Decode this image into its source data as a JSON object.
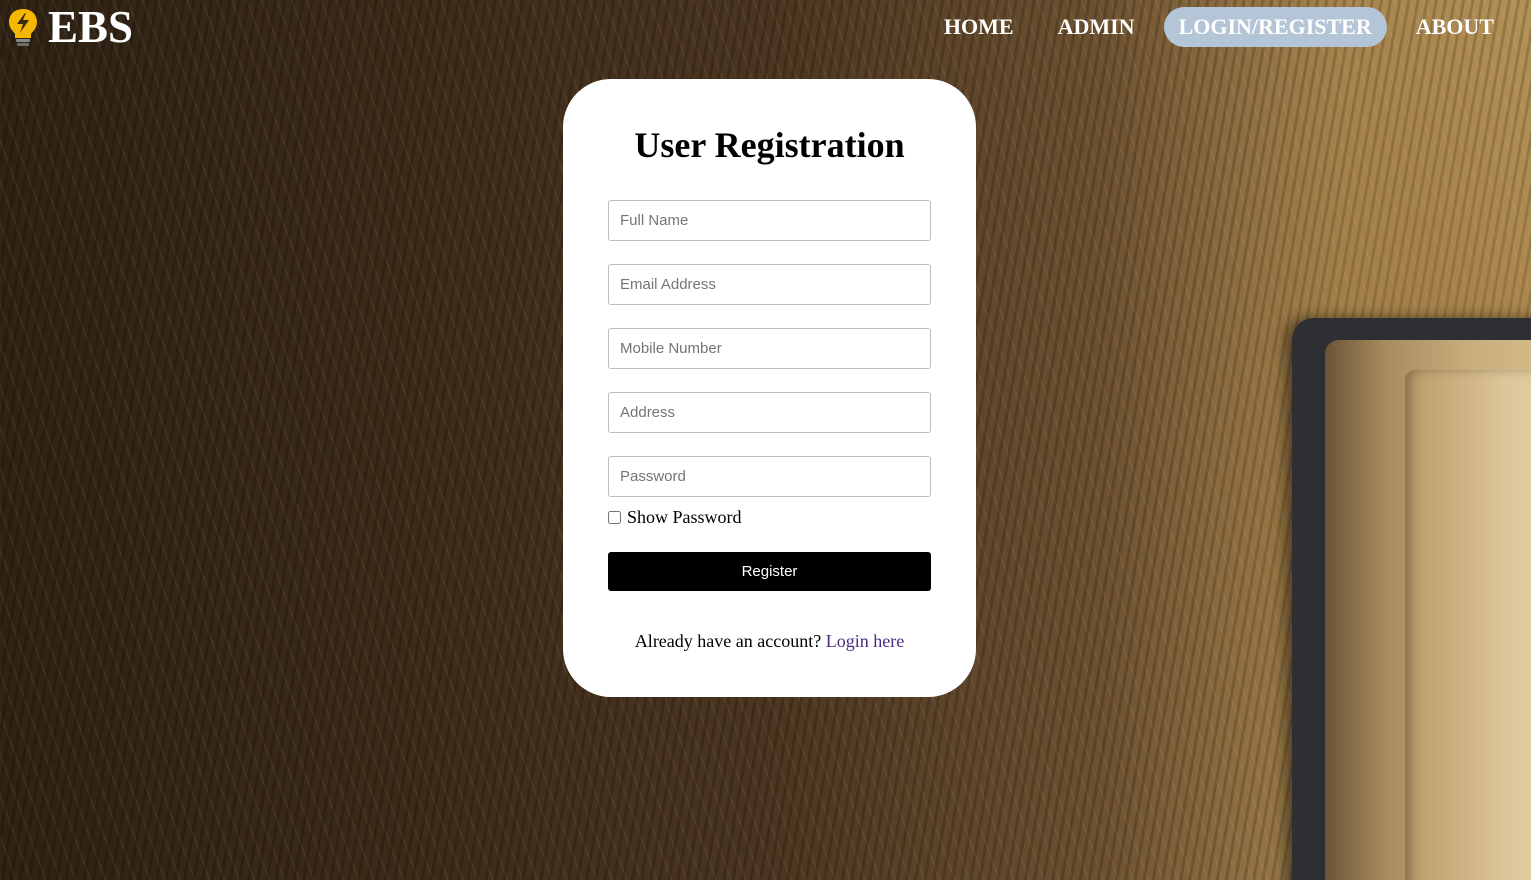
{
  "brand": {
    "name": "EBS",
    "logo_icon": "lightbulb-bolt-icon",
    "logo_color": "#f5b700"
  },
  "nav": {
    "items": [
      {
        "label": "HOME",
        "active": false
      },
      {
        "label": "ADMIN",
        "active": false
      },
      {
        "label": "LOGIN/REGISTER",
        "active": true
      },
      {
        "label": "ABOUT",
        "active": false
      }
    ],
    "active_color": "#b3c5d6"
  },
  "form": {
    "title": "User Registration",
    "fields": {
      "full_name": {
        "placeholder": "Full Name",
        "value": ""
      },
      "email": {
        "placeholder": "Email Address",
        "value": ""
      },
      "mobile": {
        "placeholder": "Mobile Number",
        "value": ""
      },
      "address": {
        "placeholder": "Address",
        "value": ""
      },
      "password": {
        "placeholder": "Password",
        "value": ""
      }
    },
    "show_password_label": "Show Password",
    "show_password_checked": false,
    "register_label": "Register",
    "login_prompt": "Already have an account?",
    "login_link": "Login here"
  },
  "colors": {
    "button_bg": "#000000",
    "link": "#4b2a82",
    "card_bg": "#ffffff"
  }
}
